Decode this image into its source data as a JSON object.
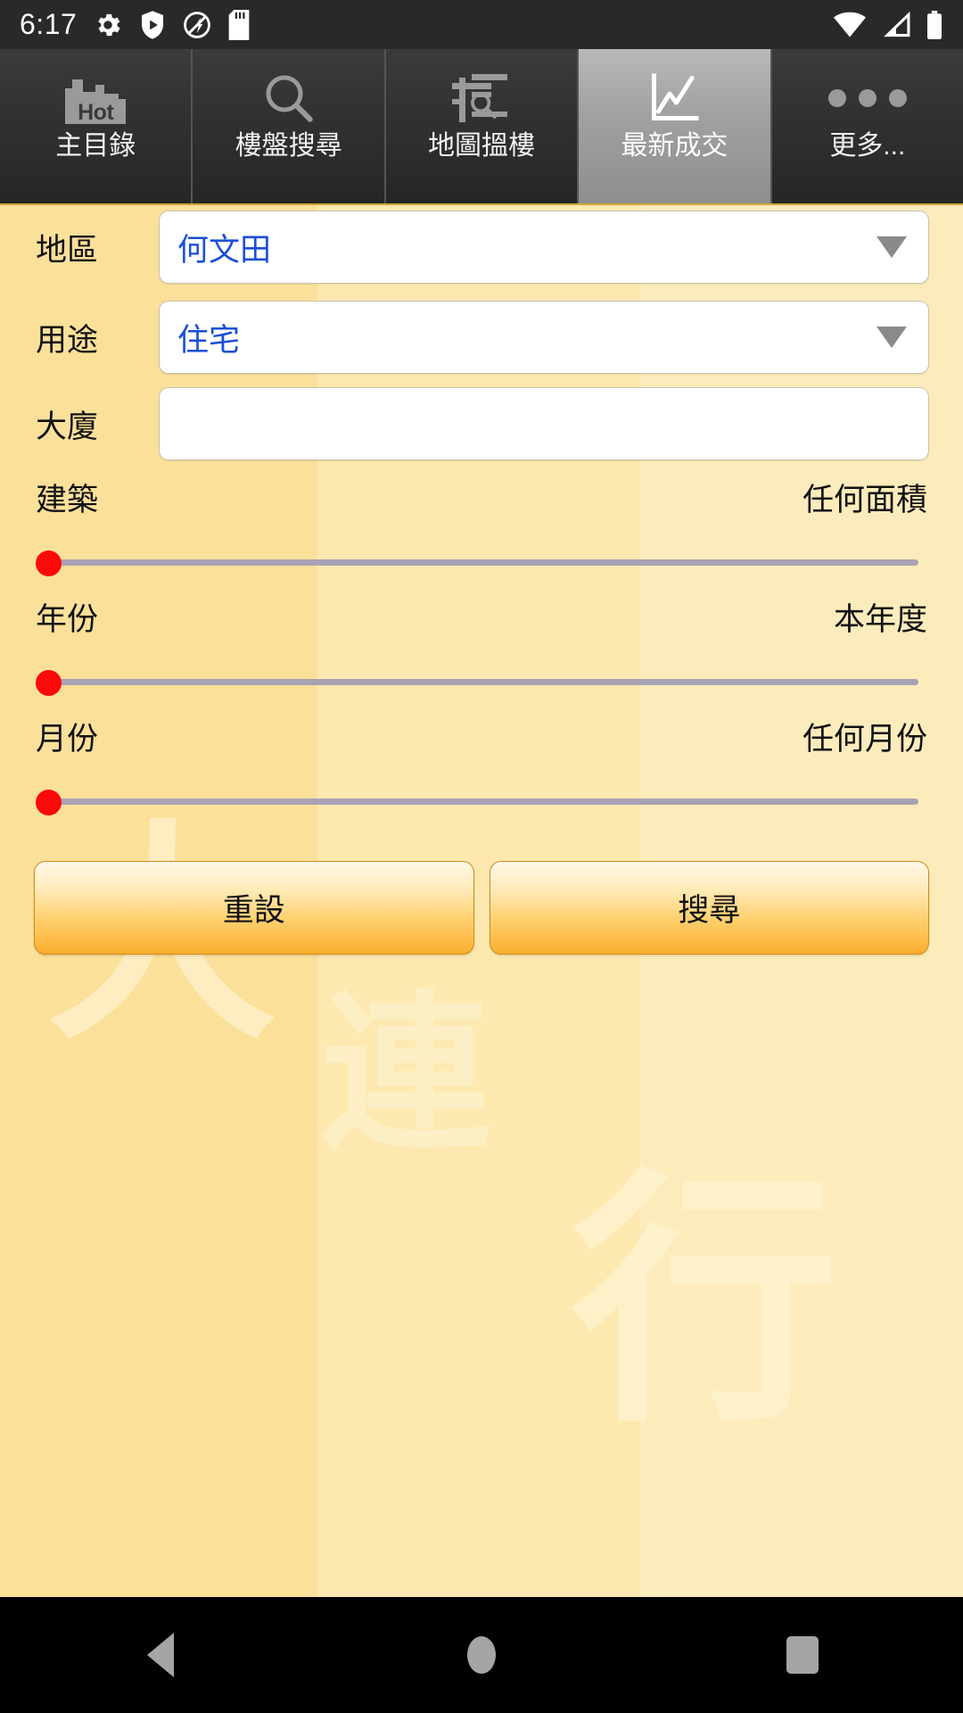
{
  "status_bar": {
    "time": "6:17",
    "left_icons": [
      "settings-gear-icon",
      "play-protect-shield-icon",
      "no-ads-blocked-icon",
      "sd-card-icon"
    ],
    "right_icons": [
      "wifi-icon",
      "cellular-signal-icon",
      "battery-icon"
    ]
  },
  "tabs": [
    {
      "label": "主目錄",
      "icon": "hot-buildings-icon",
      "selected": false
    },
    {
      "label": "樓盤搜尋",
      "icon": "magnifier-icon",
      "selected": false
    },
    {
      "label": "地圖搵樓",
      "icon": "map-search-icon",
      "selected": false
    },
    {
      "label": "最新成交",
      "icon": "line-chart-icon",
      "selected": true
    },
    {
      "label": "更多...",
      "icon": "more-dots-icon",
      "selected": false
    }
  ],
  "form": {
    "district": {
      "label": "地區",
      "value": "何文田",
      "caret": "chevron-down-icon"
    },
    "usage": {
      "label": "用途",
      "value": "住宅",
      "caret": "chevron-down-icon"
    },
    "building": {
      "label": "大廈",
      "value": "",
      "placeholder": ""
    },
    "sliders": [
      {
        "label": "建築",
        "value_text": "任何面積",
        "position_pct": 0
      },
      {
        "label": "年份",
        "value_text": "本年度",
        "position_pct": 0
      },
      {
        "label": "月份",
        "value_text": "任何月份",
        "position_pct": 0
      }
    ],
    "buttons": {
      "reset": "重設",
      "search": "搜尋"
    }
  },
  "watermark": {
    "char1": "大",
    "char2": "連",
    "char3": "行"
  },
  "nav_bar": {
    "back": "back-triangle-icon",
    "home": "home-circle-icon",
    "recents": "recents-square-icon"
  },
  "colors": {
    "accent_blue": "#1a4fd6",
    "slider_thumb": "#fb0a0a",
    "bg_left": "#fbe09a",
    "bg_mid": "#fde9b0",
    "bg_right": "#fdecbb",
    "tab_selected": "#a2a2a2",
    "button_orange": "#fcae2f"
  }
}
